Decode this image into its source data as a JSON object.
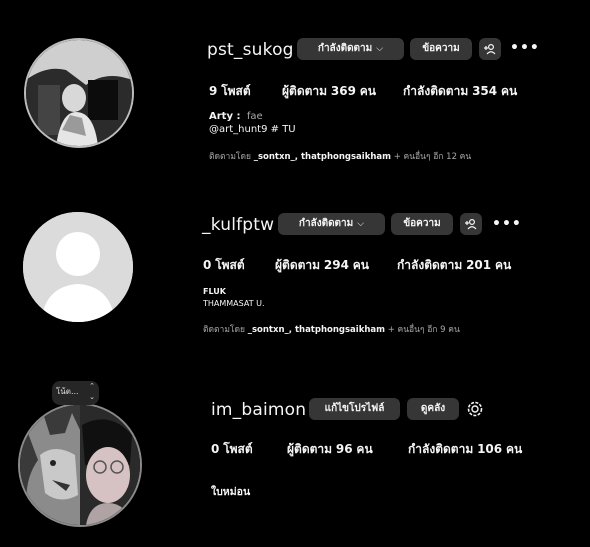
{
  "profiles": [
    {
      "username": "pst_sukog",
      "buttons": {
        "following": "กำลังติดตาม",
        "message": "ข้อความ"
      },
      "stats": {
        "posts_value": "9",
        "posts_label": "โพสต์",
        "followers_label": "ผู้ติดตาม",
        "followers_value": "369",
        "followers_unit": "คน",
        "following_label": "กำลังติดตาม",
        "following_value": "354",
        "following_unit": "คน"
      },
      "bio": {
        "name": "Arty :",
        "name_extra": "fae",
        "line2": "@art_hunt9 # TU"
      },
      "followed_by": {
        "prefix": "ติดตามโดย",
        "names": "_sontxn_, thatphongsaikham",
        "suffix": "+ คนอื่นๆ อีก 12 คน"
      }
    },
    {
      "username": "_kulfptw",
      "buttons": {
        "following": "กำลังติดตาม",
        "message": "ข้อความ"
      },
      "stats": {
        "posts_value": "0",
        "posts_label": "โพสต์",
        "followers_label": "ผู้ติดตาม",
        "followers_value": "294",
        "followers_unit": "คน",
        "following_label": "กำลังติดตาม",
        "following_value": "201",
        "following_unit": "คน"
      },
      "bio": {
        "line1": "FLUK",
        "line2": "THAMMASAT U."
      },
      "followed_by": {
        "prefix": "ติดตามโดย",
        "names": "_sontxn_, thatphongsaikham",
        "suffix": "+ คนอื่นๆ อีก 9 คน"
      }
    },
    {
      "username": "im_baimon",
      "note": "โน้ต...",
      "buttons": {
        "edit_profile": "แก้ไขโปรไฟล์",
        "view_archive": "ดูคลัง"
      },
      "stats": {
        "posts_value": "0",
        "posts_label": "โพสต์",
        "followers_label": "ผู้ติดตาม",
        "followers_value": "96",
        "followers_unit": "คน",
        "following_label": "กำลังติดตาม",
        "following_value": "106",
        "following_unit": "คน"
      },
      "bio": {
        "line1": "ใบหม่อน"
      }
    }
  ],
  "icons": {
    "add_person": "add-person-icon",
    "more": "more-options-icon",
    "settings": "settings-icon",
    "chevron": "chevron-down-icon"
  },
  "colors": {
    "background": "#000000",
    "button": "#363636",
    "text": "#f5f5f5",
    "muted": "#a8a8a8"
  }
}
